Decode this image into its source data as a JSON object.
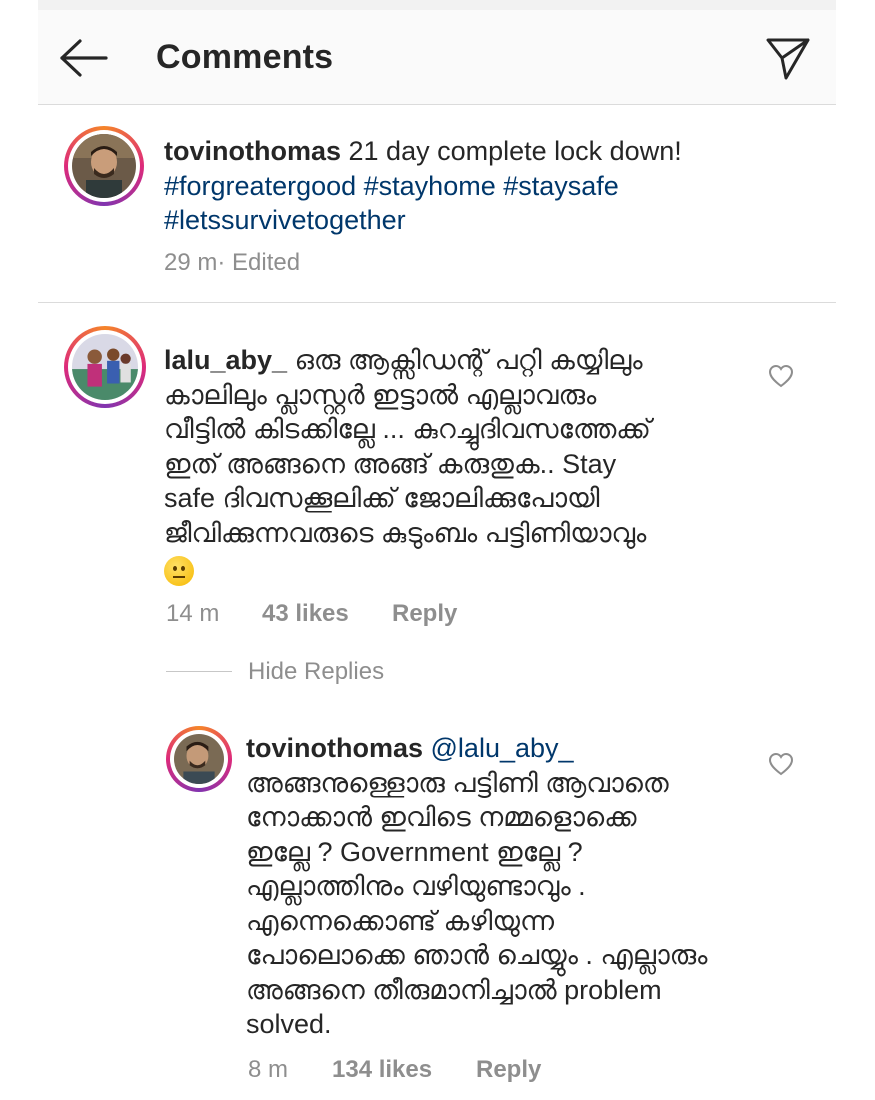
{
  "header": {
    "title": "Comments"
  },
  "post": {
    "username": "tovinothomas",
    "caption": " 21 day complete lock down!",
    "hashtags_line1": "#forgreatergood #stayhome #staysafe",
    "hashtags_line2": "#letssurvivetogether",
    "time": "29 m",
    "edited": " · Edited"
  },
  "comment": {
    "username": "lalu_aby_",
    "lines": [
      " ഒരു ആക്സിഡന്റ് പറ്റി കയ്യിലും",
      "കാലിലും പ്ലാസ്റ്റർ ഇട്ടാൽ എല്ലാവരും",
      "വീട്ടിൽ കിടക്കില്ലേ ... കുറച്ചുദിവസത്തേക്ക്",
      "ഇത് അങ്ങനെ അങ്ങ് കരുതുക.. Stay",
      "safe ദിവസക്കൂലിക്ക് ജോലിക്കുപോയി",
      "ജീവിക്കുന്നവരുടെ കുടുംബം പട്ടിണിയാവും"
    ],
    "emoji": "neutral-face-emoji",
    "time": "14 m",
    "likes": "43 likes",
    "reply": "Reply"
  },
  "hide_replies": "Hide Replies",
  "reply": {
    "username": "tovinothomas",
    "mention": " @lalu_aby_",
    "lines": [
      "അങ്ങനുള്ളൊരു പട്ടിണി ആവാതെ",
      "നോക്കാൻ ഇവിടെ നമ്മളൊക്കെ",
      "ഇല്ലേ ? Government ഇല്ലേ ?",
      "എല്ലാത്തിനും വഴിയുണ്ടാവും .",
      "എന്നെക്കൊണ്ട് കഴിയുന്ന",
      "പോലൊക്കെ ഞാൻ ചെയ്യും . എല്ലാരും",
      "അങ്ങനെ തീരുമാനിച്ചാൽ problem",
      "solved."
    ],
    "time": "8 m",
    "likes": "134 likes",
    "reply": "Reply"
  },
  "colors": {
    "text": "#262626",
    "secondary": "#8e8e8e",
    "link": "#00376b",
    "divider": "#dbdbdb"
  }
}
